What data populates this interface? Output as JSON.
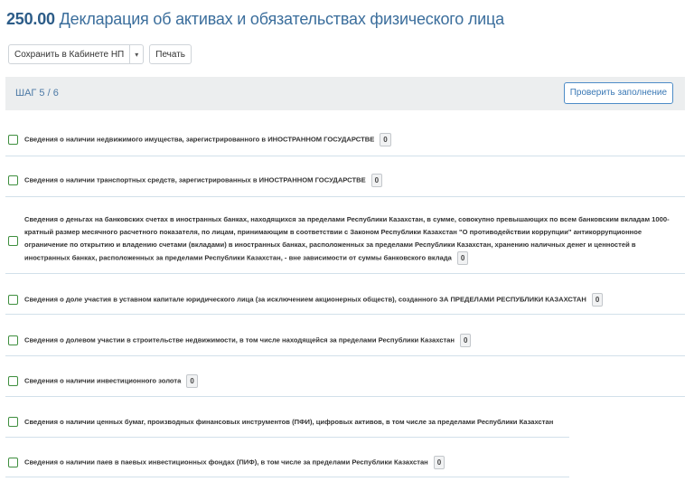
{
  "header": {
    "code": "250.00",
    "title": "Декларация об активах и обязательствах физического лица"
  },
  "toolbar": {
    "save_label": "Сохранить в Кабинете НП",
    "caret": "▾",
    "print_label": "Печать"
  },
  "step": {
    "label": "ШАГ 5 / 6",
    "check_label": "Проверить заполнение"
  },
  "items": [
    {
      "text": "Сведения о наличии недвижимого имущества, зарегистрированного в ИНОСТРАННОМ ГОСУДАРСТВЕ",
      "count": "0"
    },
    {
      "text": "Сведения о наличии транспортных средств, зарегистрированных в ИНОСТРАННОМ ГОСУДАРСТВЕ",
      "count": "0"
    },
    {
      "text": "Сведения о деньгах на банковских счетах в иностранных банках, находящихся за пределами Республики Казахстан, в сумме, совокупно превышающих по всем банковским вкладам 1000-кратный размер месячного расчетного показателя, по лицам, принимающим в соответствии с Законом Республики Казахстан \"О противодействии коррупции\" антикоррупционное ограничение по открытию и владению счетами (вкладами) в иностранных банках, расположенных за пределами Республики Казахстан, хранению наличных денег и ценностей в иностранных банках, расположенных за пределами Республики Казахстан, - вне зависимости от суммы банковского вклада",
      "count": "0"
    },
    {
      "text": "Сведения о доле участия в уставном капитале юридического лица (за исключением акционерных обществ), созданного ЗА ПРЕДЕЛАМИ РЕСПУБЛИКИ КАЗАХСТАН",
      "count": "0"
    },
    {
      "text": "Сведения о долевом участии в строительстве недвижимости, в том числе находящейся за пределами Республики Казахстан",
      "count": "0"
    },
    {
      "text": "Сведения о наличии инвестиционного золота",
      "count": "0"
    },
    {
      "text": "Сведения о наличии ценных бумаг, производных финансовых инструментов (ПФИ), цифровых активов, в том числе за пределами Республики Казахстан"
    },
    {
      "text": "Сведения о наличии паев в паевых инвестиционных фондах (ПИФ), в том числе за пределами Республики Казахстан",
      "count": "0"
    }
  ]
}
